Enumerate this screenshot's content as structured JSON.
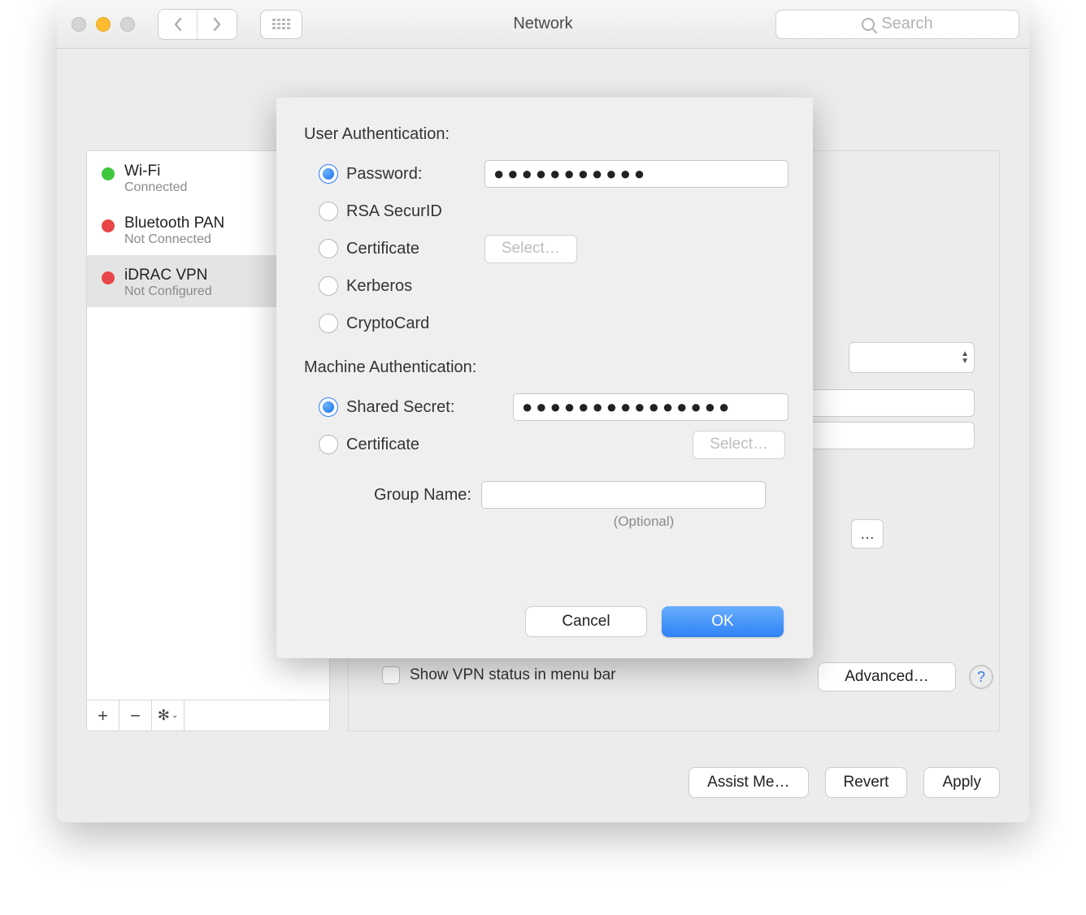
{
  "titlebar": {
    "title": "Network",
    "search_placeholder": "Search"
  },
  "sidebar": {
    "items": [
      {
        "name": "Wi-Fi",
        "status": "Connected",
        "dot": "green"
      },
      {
        "name": "Bluetooth PAN",
        "status": "Not Connected",
        "dot": "red"
      },
      {
        "name": "iDRAC VPN",
        "status": "Not Configured",
        "dot": "red",
        "selected": true
      }
    ],
    "footer": {
      "add": "+",
      "remove": "−",
      "gear": "✻⌄"
    }
  },
  "main": {
    "show_status_label": "Show VPN status in menu bar",
    "advanced_label": "Advanced…",
    "peek_btn": "…"
  },
  "bottom": {
    "assist": "Assist Me…",
    "revert": "Revert",
    "apply": "Apply"
  },
  "sheet": {
    "user_auth_title": "User Authentication:",
    "machine_auth_title": "Machine Authentication:",
    "user_opts": {
      "password": "Password:",
      "rsa": "RSA SecurID",
      "cert": "Certificate",
      "kerb": "Kerberos",
      "crypto": "CryptoCard"
    },
    "machine_opts": {
      "shared": "Shared Secret:",
      "cert": "Certificate"
    },
    "select_label": "Select…",
    "password_value": "●●●●●●●●●●●",
    "shared_secret_value": "●●●●●●●●●●●●●●●",
    "group_name_label": "Group Name:",
    "group_name_value": "",
    "optional": "(Optional)",
    "cancel": "Cancel",
    "ok": "OK"
  }
}
